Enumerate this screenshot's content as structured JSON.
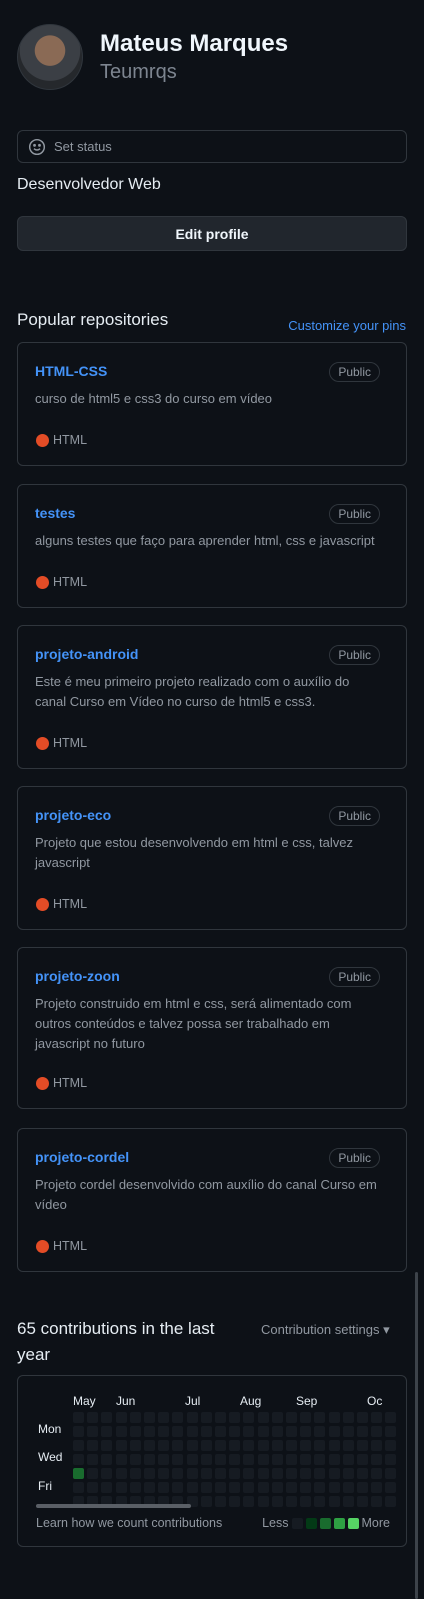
{
  "profile": {
    "name": "Mateus Marques",
    "login": "Teumrqs",
    "set_status": "Set status",
    "bio": "Desenvolvedor Web",
    "edit_label": "Edit profile"
  },
  "popular": {
    "title": "Popular repositories",
    "customize": "Customize your pins",
    "repos": [
      {
        "name": "HTML-CSS",
        "visibility": "Public",
        "description": "curso de html5 e css3 do curso em vídeo",
        "language": "HTML"
      },
      {
        "name": "testes",
        "visibility": "Public",
        "description": "alguns testes que faço para aprender html, css e javascript",
        "language": "HTML"
      },
      {
        "name": "projeto-android",
        "visibility": "Public",
        "description": "Este é meu primeiro projeto realizado com o auxílio do canal Curso em Vídeo no curso de html5 e css3.",
        "language": "HTML"
      },
      {
        "name": "projeto-eco",
        "visibility": "Public",
        "description": "Projeto que estou desenvolvendo em html e css, talvez javascript",
        "language": "HTML"
      },
      {
        "name": "projeto-zoon",
        "visibility": "Public",
        "description": "Projeto construido em html e css, será alimentado com outros conteúdos e talvez possa ser trabalhado em javascript no futuro",
        "language": "HTML"
      },
      {
        "name": "projeto-cordel",
        "visibility": "Public",
        "description": "Projeto cordel desenvolvido com auxílio do canal Curso em vídeo",
        "language": "HTML"
      }
    ]
  },
  "contributions": {
    "title": "65 contributions in the last year",
    "settings": "Contribution settings",
    "months": [
      "May",
      "Jun",
      "Jul",
      "Aug",
      "Sep",
      "Oc"
    ],
    "days": [
      "Mon",
      "Wed",
      "Fri"
    ],
    "learn": "Learn how we count contributions",
    "less": "Less",
    "more": "More",
    "legend_colors": [
      "#161b22",
      "#033a16",
      "#196c2e",
      "#2ea043",
      "#56d364"
    ],
    "active_cells": [
      {
        "week": 0,
        "day": 4,
        "level": 2
      }
    ]
  }
}
